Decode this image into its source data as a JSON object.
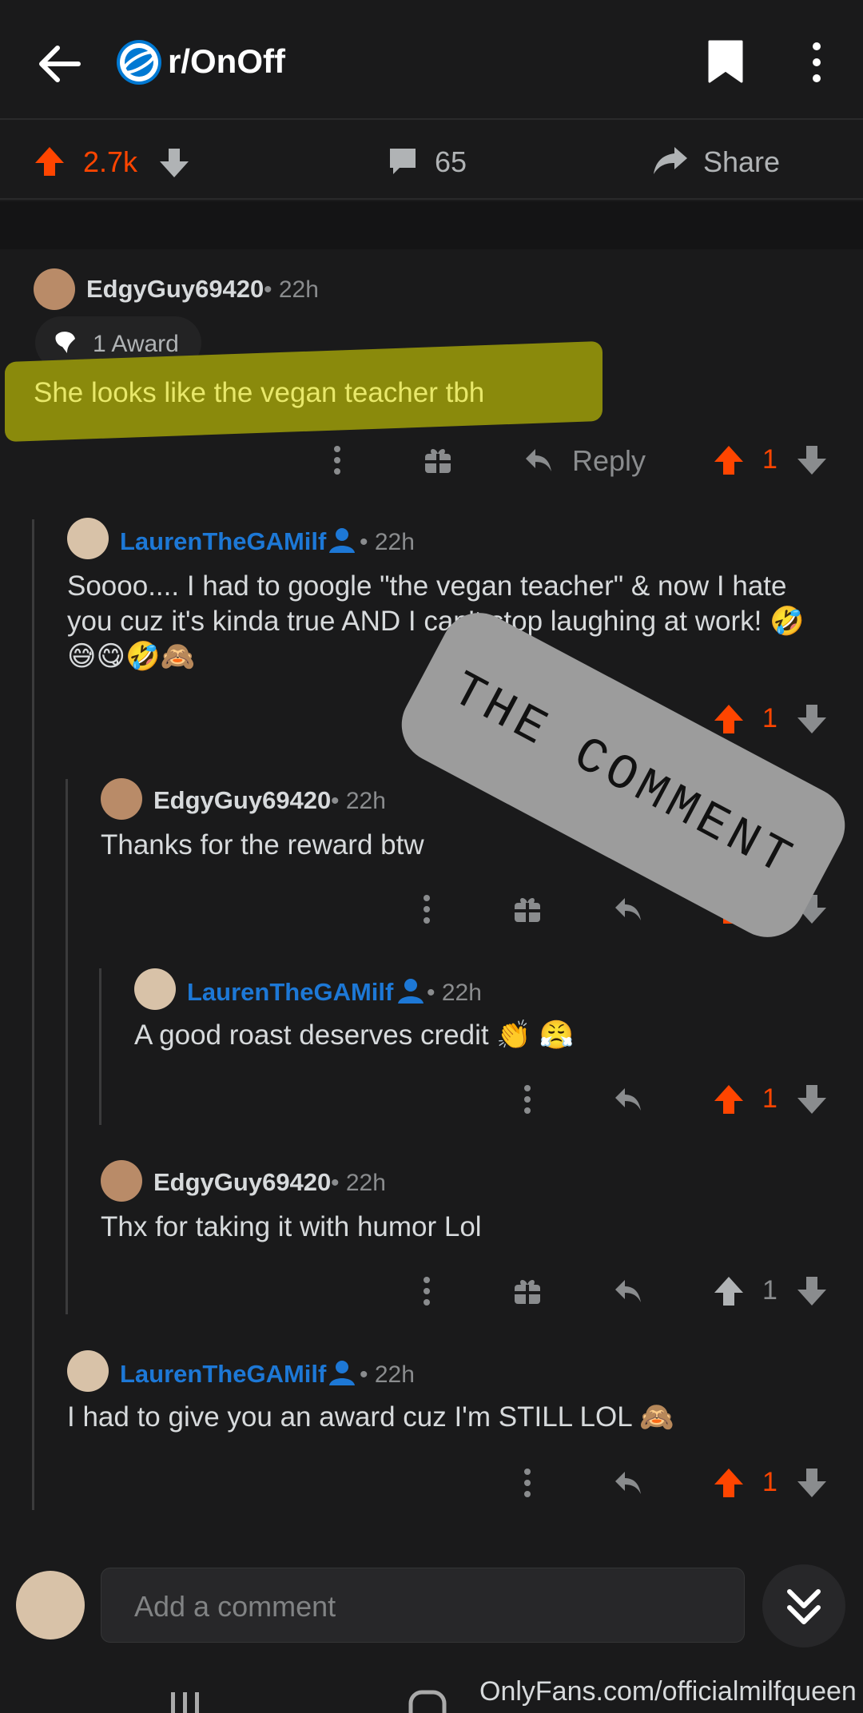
{
  "header": {
    "subreddit": "r/OnOff"
  },
  "actions": {
    "upvotes": "2.7k",
    "comments": "65",
    "share": "Share"
  },
  "comments": [
    {
      "user": "EdgyGuy69420",
      "time": "• 22h",
      "award": "1 Award",
      "text": "She looks like the vegan teacher tbh",
      "votes": "1",
      "reply": "Reply"
    },
    {
      "user": "LaurenTheGAMilf",
      "time": "• 22h",
      "text_line1": "Soooo.... I had to google \"the vegan teacher\" & now I hate",
      "text_line2": "you cuz it's kinda true AND I can't stop laughing at work! 🤣",
      "text_line3": "😅😋🤣🙈",
      "votes": "1"
    },
    {
      "user": "EdgyGuy69420",
      "time": "• 22h",
      "text": "Thanks for the reward btw",
      "votes": "2"
    },
    {
      "user": "LaurenTheGAMilf",
      "time": "• 22h",
      "text": "A good roast deserves credit 👏 😤",
      "votes": "1"
    },
    {
      "user": "EdgyGuy69420",
      "time": "• 22h",
      "text": "Thx for taking it with humor Lol",
      "votes": "1"
    },
    {
      "user": "LaurenTheGAMilf",
      "time": "• 22h",
      "text": "I had to give you an award cuz I'm STILL LOL 🙈",
      "votes": "1"
    }
  ],
  "stamp": "THE  COMMENT",
  "composer": {
    "placeholder": "Add a comment"
  },
  "watermark": "OnlyFans.com/officialmilfqueen",
  "colors": {
    "upvote": "#ff4500",
    "op_blue": "#1d78d6",
    "highlight": "#8a8a0c"
  }
}
